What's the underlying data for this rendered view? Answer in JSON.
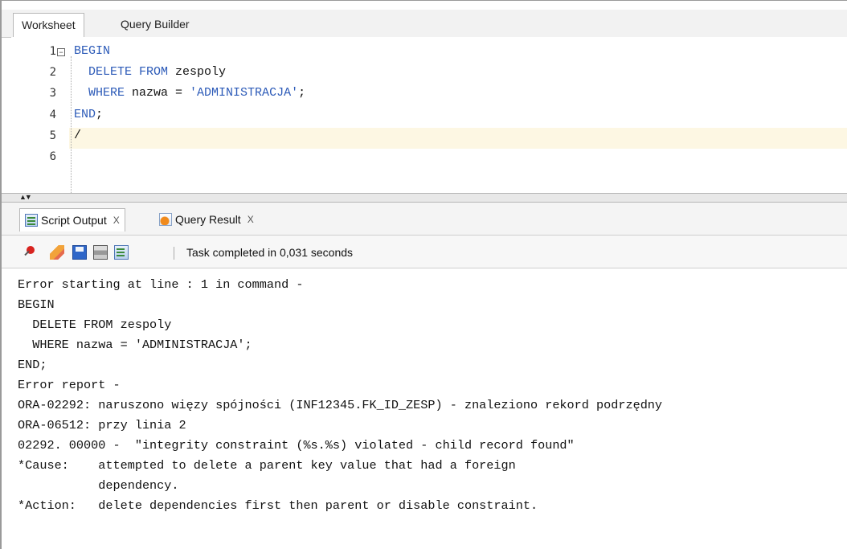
{
  "worksheet_tabs": [
    {
      "label": "Worksheet",
      "active": true
    },
    {
      "label": "Query Builder",
      "active": false
    }
  ],
  "editor": {
    "line_numbers": [
      "1",
      "2",
      "3",
      "4",
      "5",
      "6"
    ],
    "current_line": 5,
    "code": {
      "l1": {
        "kw": "BEGIN"
      },
      "l2": {
        "kw": "DELETE FROM",
        "rest": " zespoly"
      },
      "l3": {
        "kw": "WHERE",
        "mid": " nazwa = ",
        "str": "'ADMINISTRACJA'",
        "end": ";"
      },
      "l4": {
        "kw": "END",
        "end": ";"
      },
      "l5": {
        "text": "/"
      }
    }
  },
  "output_tabs": [
    {
      "label": "Script Output",
      "close": "X",
      "icon": "script-output-icon",
      "active": true
    },
    {
      "label": "Query Result",
      "close": "X",
      "icon": "query-result-icon",
      "active": false
    }
  ],
  "toolbar": {
    "icons": [
      "pin-icon",
      "eraser-icon",
      "save-icon",
      "print-icon",
      "open-file-icon"
    ],
    "status": "Task completed in 0,031 seconds"
  },
  "output_lines": [
    "Error starting at line : 1 in command -",
    "BEGIN",
    "  DELETE FROM zespoly",
    "  WHERE nazwa = 'ADMINISTRACJA';",
    "END;",
    "Error report -",
    "ORA-02292: naruszono więzy spójności (INF12345.FK_ID_ZESP) - znaleziono rekord podrzędny",
    "ORA-06512: przy linia 2",
    "02292. 00000 -  \"integrity constraint (%s.%s) violated - child record found\"",
    "*Cause:    attempted to delete a parent key value that had a foreign",
    "           dependency.",
    "*Action:   delete dependencies first then parent or disable constraint."
  ],
  "colors": {
    "keyword": "#2d5bb8",
    "current_line_highlight": "#fdf7e3"
  }
}
